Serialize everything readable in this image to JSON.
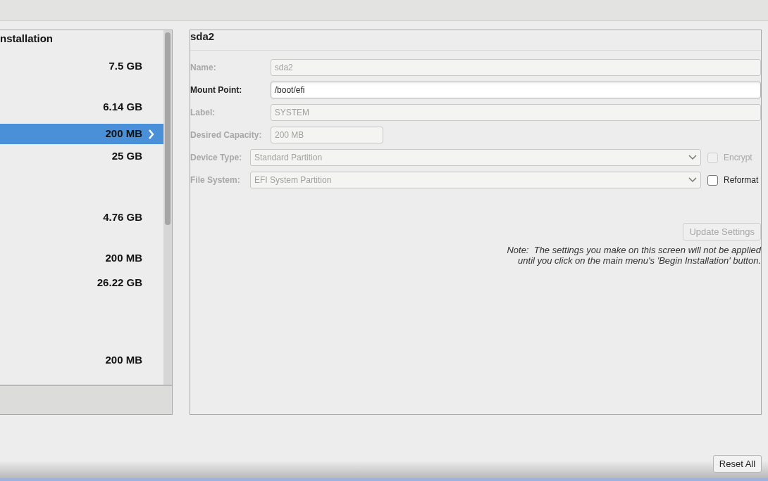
{
  "device_list": {
    "heading": "nstallation",
    "items": [
      {
        "size": "7.5 GB",
        "selected": false
      },
      {
        "size": "6.14 GB",
        "selected": false
      },
      {
        "size": "200 MB",
        "selected": true
      },
      {
        "size": "25 GB",
        "selected": false
      },
      {
        "size": "4.76 GB",
        "selected": false
      },
      {
        "size": "200 MB",
        "selected": false
      },
      {
        "size": "26.22 GB",
        "selected": false
      },
      {
        "size": "200 MB",
        "selected": false
      }
    ]
  },
  "details": {
    "title": "sda2",
    "fields": [
      {
        "kind": "text",
        "label": "Name:",
        "value": "sda2",
        "disabled": true
      },
      {
        "kind": "text",
        "label": "Mount Point:",
        "value": "/boot/efi",
        "disabled": false
      },
      {
        "kind": "text",
        "label": "Label:",
        "value": "SYSTEM",
        "disabled": true
      },
      {
        "kind": "short",
        "label": "Desired Capacity:",
        "value": "200 MB",
        "disabled": true
      },
      {
        "kind": "select",
        "label": "Device Type:",
        "value": "Standard Partition",
        "disabled": true,
        "checkbox": {
          "label": "Encrypt",
          "checked": false,
          "disabled": true
        }
      },
      {
        "kind": "select",
        "label": "File System:",
        "value": "EFI System Partition",
        "disabled": true,
        "checkbox": {
          "label": "Reformat",
          "checked": false,
          "disabled": false
        }
      }
    ],
    "update_button": {
      "label": "Update Settings",
      "disabled": true
    },
    "note": [
      "Note:  The settings you make on this screen will not be applied",
      "until you click on the main menu's 'Begin Installation' button."
    ]
  },
  "reset_button": {
    "label": "Reset All"
  }
}
